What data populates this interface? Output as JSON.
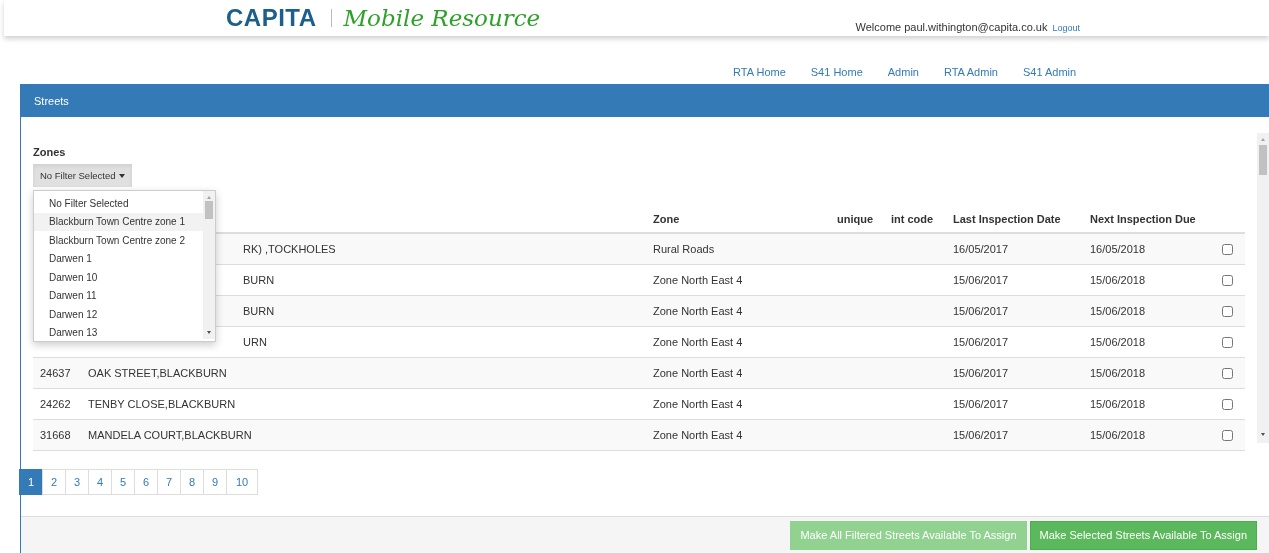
{
  "header": {
    "brand": "CAPITA",
    "product": "Mobile Resource",
    "welcome": "Welcome paul.withington@capita.co.uk",
    "logout": "Logout"
  },
  "nav": [
    "RTA Home",
    "S41 Home",
    "Admin",
    "RTA Admin",
    "S41 Admin"
  ],
  "panel": {
    "title": "Streets"
  },
  "filter": {
    "label": "Zones",
    "value": "No Filter Selected",
    "expanded": true,
    "options": [
      {
        "label": "No Filter Selected",
        "highlighted": false
      },
      {
        "label": "Blackburn Town Centre zone 1",
        "highlighted": true
      },
      {
        "label": "Blackburn Town Centre zone 2",
        "highlighted": false
      },
      {
        "label": "Darwen 1",
        "highlighted": false
      },
      {
        "label": "Darwen 10",
        "highlighted": false
      },
      {
        "label": "Darwen 11",
        "highlighted": false
      },
      {
        "label": "Darwen 12",
        "highlighted": false
      },
      {
        "label": "Darwen 13",
        "highlighted": false
      }
    ]
  },
  "table": {
    "columns": [
      "Zone",
      "unique",
      "int code",
      "Last Inspection Date",
      "Next Inspection Due"
    ],
    "rows": [
      {
        "name": "RK) ,TOCKHOLES",
        "zone": "Rural Roads",
        "last": "16/05/2017",
        "next": "16/05/2018",
        "checked": false
      },
      {
        "name": "BURN",
        "zone": "Zone North East 4",
        "last": "15/06/2017",
        "next": "15/06/2018",
        "checked": false
      },
      {
        "name": "BURN",
        "zone": "Zone North East 4",
        "last": "15/06/2017",
        "next": "15/06/2018",
        "checked": false
      },
      {
        "name": "URN",
        "zone": "Zone North East 4",
        "last": "15/06/2017",
        "next": "15/06/2018",
        "checked": false
      },
      {
        "id": "24637",
        "name": "OAK STREET,BLACKBURN",
        "zone": "Zone North East 4",
        "last": "15/06/2017",
        "next": "15/06/2018",
        "checked": false
      },
      {
        "id": "24262",
        "name": "TENBY CLOSE,BLACKBURN",
        "zone": "Zone North East 4",
        "last": "15/06/2017",
        "next": "15/06/2018",
        "checked": false
      },
      {
        "id": "31668",
        "name": "MANDELA COURT,BLACKBURN",
        "zone": "Zone North East 4",
        "last": "15/06/2017",
        "next": "15/06/2018",
        "checked": false
      }
    ]
  },
  "pagination": [
    {
      "label": "1",
      "selected": true
    },
    {
      "label": "2",
      "selected": false
    },
    {
      "label": "3",
      "selected": false
    },
    {
      "label": "4",
      "selected": false
    },
    {
      "label": "5",
      "selected": false
    },
    {
      "label": "6",
      "selected": false
    },
    {
      "label": "7",
      "selected": false
    },
    {
      "label": "8",
      "selected": false
    },
    {
      "label": "9",
      "selected": false
    },
    {
      "label": "10",
      "selected": false
    }
  ],
  "actions": [
    {
      "label": "Make All Filtered Streets Available To Assign",
      "disabled": true
    },
    {
      "label": "Make Selected Streets Available To Assign",
      "disabled": false
    }
  ]
}
